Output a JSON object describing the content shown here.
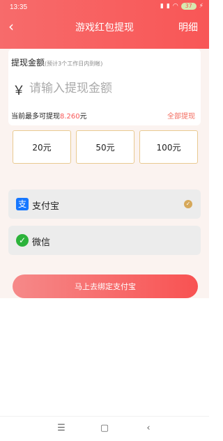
{
  "status_bar": {
    "time": "13:35",
    "battery": "37"
  },
  "header": {
    "back_icon": "chevron-left-icon",
    "title": "游戏红包提现",
    "detail_label": "明细"
  },
  "withdraw": {
    "label": "提现金额",
    "hint": "(预计3个工作日内到帐)",
    "currency_symbol": "￥",
    "placeholder": "请输入提现金额",
    "max_prefix": "当前最多可提现",
    "max_amount": "8.260",
    "max_unit": "元",
    "all_label": "全部提现"
  },
  "quick_amounts": [
    "20元",
    "50元",
    "100元"
  ],
  "payment_methods": [
    {
      "label": "支付宝",
      "icon": "alipay-icon",
      "selected": true
    },
    {
      "label": "微信",
      "icon": "wechat-icon",
      "selected": false
    }
  ],
  "action_button": {
    "label": "马上去绑定支付宝"
  },
  "colors": {
    "header": "#f85656",
    "accent": "#f36b5e",
    "amount_border": "#e9c990",
    "check": "#d6a85a",
    "alipay": "#1677ff",
    "wechat": "#2cb33b"
  },
  "system_nav": {
    "icons": [
      "menu-icon",
      "home-icon",
      "back-icon"
    ]
  }
}
